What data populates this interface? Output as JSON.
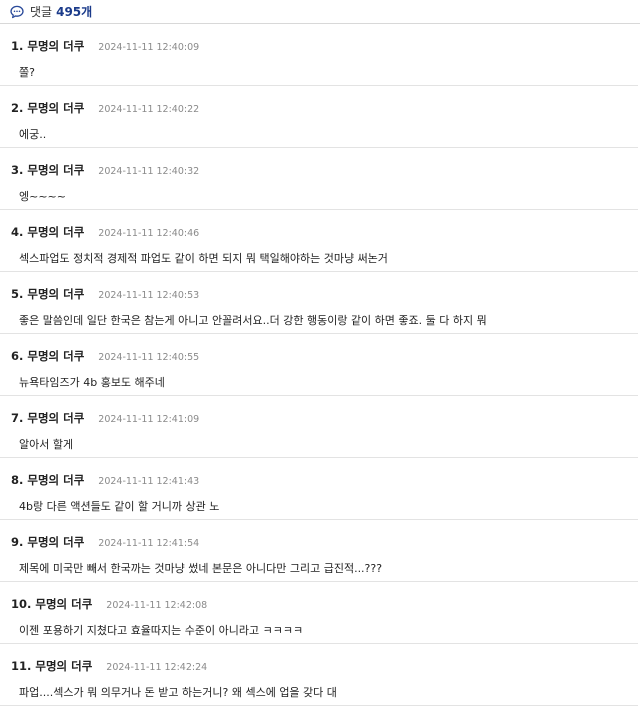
{
  "header": {
    "label": "댓글",
    "count": "495개"
  },
  "comments": [
    {
      "num": "1.",
      "author": "무명의 더쿠",
      "time": "2024-11-11 12:40:09",
      "text": "쫄?"
    },
    {
      "num": "2.",
      "author": "무명의 더쿠",
      "time": "2024-11-11 12:40:22",
      "text": "에궁.."
    },
    {
      "num": "3.",
      "author": "무명의 더쿠",
      "time": "2024-11-11 12:40:32",
      "text": "엥~~~~"
    },
    {
      "num": "4.",
      "author": "무명의 더쿠",
      "time": "2024-11-11 12:40:46",
      "text": "섹스파업도 정치적 경제적 파업도 같이 하면 되지 뭐 택일해야하는 것마냥 써논거"
    },
    {
      "num": "5.",
      "author": "무명의 더쿠",
      "time": "2024-11-11 12:40:53",
      "text": "좋은 말씀인데 일단 한국은 참는게 아니고 안꼴려서요..더 강한 행동이랑 같이 하면 좋죠. 둘 다 하지 뭐"
    },
    {
      "num": "6.",
      "author": "무명의 더쿠",
      "time": "2024-11-11 12:40:55",
      "text": "뉴욕타임즈가 4b 홍보도 해주네"
    },
    {
      "num": "7.",
      "author": "무명의 더쿠",
      "time": "2024-11-11 12:41:09",
      "text": "알아서 할게"
    },
    {
      "num": "8.",
      "author": "무명의 더쿠",
      "time": "2024-11-11 12:41:43",
      "text": "4b랑 다른 액션들도 같이 할 거니까 상관 노"
    },
    {
      "num": "9.",
      "author": "무명의 더쿠",
      "time": "2024-11-11 12:41:54",
      "text": "제목에 미국만 빼서 한국까는 것마냥 썼네 본문은 아니다만 그리고 급진적...???"
    },
    {
      "num": "10.",
      "author": "무명의 더쿠",
      "time": "2024-11-11 12:42:08",
      "text": "이젠 포용하기 지쳤다고 효율따지는 수준이 아니라고 ㅋㅋㅋㅋ"
    },
    {
      "num": "11.",
      "author": "무명의 더쿠",
      "time": "2024-11-11 12:42:24",
      "text": "파업....섹스가 뭐 의무거나 돈 받고 하는거니? 왜 섹스에 업을 갖다 대"
    }
  ]
}
